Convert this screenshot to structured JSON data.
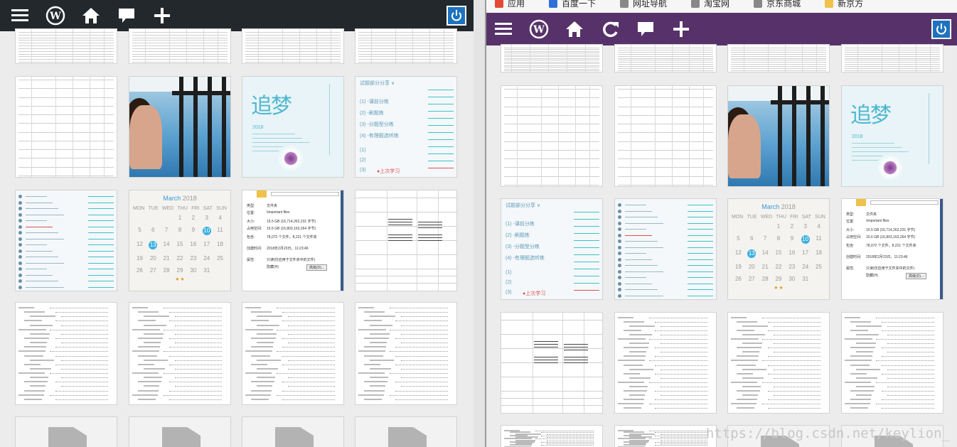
{
  "left_toolbar": {
    "icons": [
      "menu-icon",
      "wordpress-icon",
      "home-icon",
      "comment-icon",
      "plus-icon"
    ],
    "power_icon": "power-icon"
  },
  "bookmarks": {
    "items": [
      {
        "label": "应用",
        "icon": "apps-icon",
        "color": "#e44a33"
      },
      {
        "label": "百度一下",
        "icon": "baidu-icon",
        "color": "#2f6fd8"
      },
      {
        "label": "网址导航",
        "icon": "page-icon",
        "color": "#888888"
      },
      {
        "label": "淘宝网",
        "icon": "page-icon",
        "color": "#888888"
      },
      {
        "label": "京东商城",
        "icon": "page-icon",
        "color": "#888888"
      },
      {
        "label": "新京方",
        "icon": "folder-icon",
        "color": "#f0c14b"
      }
    ]
  },
  "right_toolbar": {
    "icons": [
      "menu-icon",
      "wordpress-icon",
      "home-icon",
      "refresh-icon",
      "comment-icon",
      "plus-icon"
    ],
    "power_icon": "power-icon"
  },
  "calendar": {
    "month": "March",
    "year": "2018",
    "weekdays": [
      "MON",
      "TUE",
      "WED",
      "THU",
      "FRI",
      "SAT",
      "SUN"
    ],
    "days": [
      "",
      "",
      "",
      "1",
      "2",
      "3",
      "4",
      "5",
      "6",
      "7",
      "8",
      "9",
      "10",
      "11",
      "12",
      "13",
      "14",
      "15",
      "16",
      "17",
      "18",
      "19",
      "20",
      "21",
      "22",
      "23",
      "24",
      "25",
      "26",
      "27",
      "28",
      "29",
      "30",
      "31",
      ""
    ],
    "highlight": [
      "10",
      "13"
    ]
  },
  "dream": {
    "title": "追梦",
    "year": "2018"
  },
  "list_tile": {
    "header": "试题部分分享 ∨",
    "items": [
      "(1) -课前分练",
      "(2) -刷题练",
      "(3) -分题型分练",
      "(4) -有理题选听练"
    ],
    "bottom": [
      "(1)",
      "(2)",
      "(3)"
    ],
    "red_label": "●上次学习"
  },
  "props_tile": {
    "rows": [
      {
        "k": "类型:",
        "v": "文件夹"
      },
      {
        "k": "位置:",
        "v": "\\important files"
      },
      {
        "k": "大小:",
        "v": "15.5 GB (16,714,262,231 字节)"
      },
      {
        "k": "占用空间:",
        "v": "15.6 GB (16,803,163,264 字节)"
      },
      {
        "k": "包含:",
        "v": "78,072 个文件，8,221 个文件夹"
      },
      {
        "k": "创建时间:",
        "v": "2018年2月23日，11:23:46"
      },
      {
        "k": "属性:",
        "v": "只读(仅应用于文件夹中的文件)"
      },
      {
        "k": "",
        "v": "隐藏(H)"
      },
      {
        "k": "",
        "v": "高级(D)..."
      }
    ]
  },
  "watermark": "https://blog.csdn.net/keylion_"
}
